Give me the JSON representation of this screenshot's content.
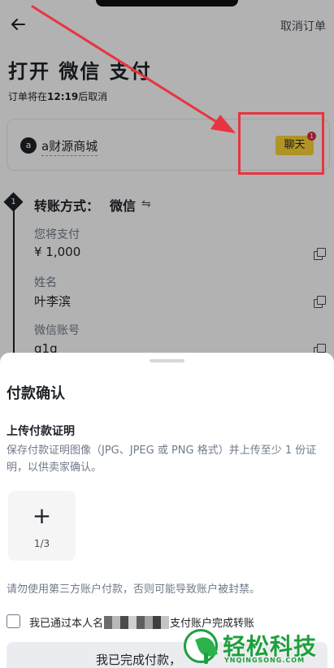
{
  "header": {
    "cancel_order_label": "取消订单",
    "title": "打开 微信 支付",
    "countdown_prefix": "订单将在",
    "countdown_time": "12:19",
    "countdown_suffix": "后取消"
  },
  "merchant": {
    "avatar_letter": "a",
    "name": "a财源商城",
    "chat_label": "聊天",
    "chat_badge_count": "1"
  },
  "payment": {
    "step_number": "1",
    "method_label": "转账方式：",
    "method_value": "微信",
    "swap_symbol": "⇋",
    "fields": [
      {
        "label": "您将支付",
        "value": "¥ 1,000"
      },
      {
        "label": "姓名",
        "value": "叶李滨"
      },
      {
        "label": "微信账号",
        "value": "g1g"
      }
    ]
  },
  "sheet": {
    "title": "付款确认",
    "upload_title": "上传付款证明",
    "upload_description": "保存付款证明图像（JPG、JPEG 或 PNG 格式）并上传至少 1 份证明，以供卖家确认。",
    "upload_plus": "+",
    "upload_counter": "1/3",
    "warning": "请勿使用第三方账户付款，否则可能导致账户被封禁。",
    "agree_prefix": "我已通过本人名",
    "agree_suffix": "支付账户完成转账",
    "done_button": "我已完成付款，"
  },
  "watermark": {
    "text": "轻松科技",
    "sub": "YNQINGSONG.COM"
  },
  "colors": {
    "accent_yellow": "#fcd535",
    "annotation_red": "#e8343f",
    "badge_red": "#cf304a",
    "watermark_green": "#1e9f3e"
  },
  "icons": [
    "back-arrow-icon",
    "swap-icon",
    "copy-icon",
    "plus-icon",
    "checkbox-icon",
    "leaf-logo-icon"
  ]
}
